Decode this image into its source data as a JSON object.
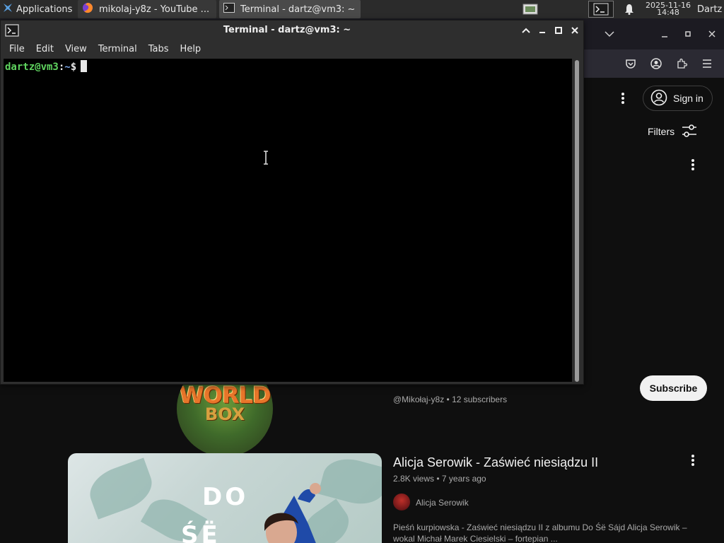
{
  "panel": {
    "applications_label": "Applications",
    "tasks": [
      {
        "label": "mikolaj-y8z - YouTube ..."
      },
      {
        "label": "Terminal - dartz@vm3: ~"
      }
    ],
    "clock_date": "2025-11-16",
    "clock_time": "14:48",
    "user": "Dartz"
  },
  "terminal": {
    "title": "Terminal - dartz@vm3: ~",
    "menu": [
      "File",
      "Edit",
      "View",
      "Terminal",
      "Tabs",
      "Help"
    ],
    "prompt_user": "dartz@vm3",
    "prompt_colon": ":",
    "prompt_path": "~",
    "prompt_sign": "$"
  },
  "youtube": {
    "sign_in_label": "Sign in",
    "filters_label": "Filters",
    "channel_meta": "@Mikołaj-y8z • 12 subscribers",
    "subscribe_label": "Subscribe",
    "avatar_text_1": "WORLD",
    "avatar_text_2": "BOX",
    "video": {
      "title": "Alicja Serowik - Zaświeć niesiądzu II",
      "stats": "2.8K views • 7 years ago",
      "author": "Alicja Serowik",
      "description": "Pieśń kurpiowska - Zaświeć niesiądzu II z albumu Do Śë Sájd Alicja Serowik – wokal Michał Marek Ciesielski – fortepian ...",
      "thumb_text_1": "DO",
      "thumb_text_2": "ŚË"
    }
  },
  "colors": {
    "terminal_bg": "#000000",
    "prompt_user": "#5fd35f",
    "prompt_path": "#7aa6e8",
    "panel_bg": "#2b2b2b",
    "yt_bg": "#0f0f0f"
  }
}
